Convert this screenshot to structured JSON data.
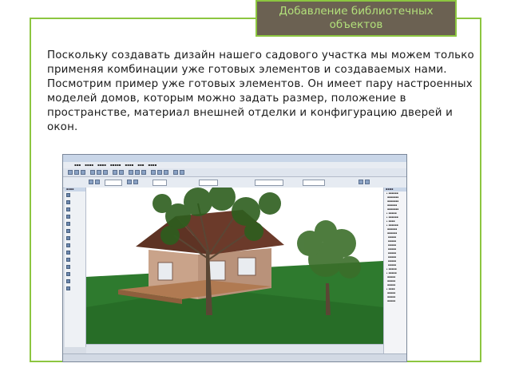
{
  "slide": {
    "title_line1": "Добавление библиотечных",
    "title_line2": "объектов",
    "body": "Поскольку создавать дизайн нашего садового участка мы можем только применяя комбинации уже готовых элементов и создаваемых нами. Посмотрим пример уже готовых элементов. Он имеет пару настроенных моделей домов, которым можно задать размер, положение в пространстве, материал внешней отделки и конфигурацию дверей и окон."
  },
  "colors": {
    "accent_green": "#8cc640",
    "title_bg": "#6b6152",
    "title_text": "#b2e07a",
    "sky": "#ffffff",
    "grass": "#2e7a2e",
    "roof": "#6b3a2a",
    "walls": "#c9a38a"
  },
  "screenshot": {
    "icons": [
      "toolbox-panel-icon",
      "navigator-tree-icon",
      "3d-view-icon"
    ]
  }
}
